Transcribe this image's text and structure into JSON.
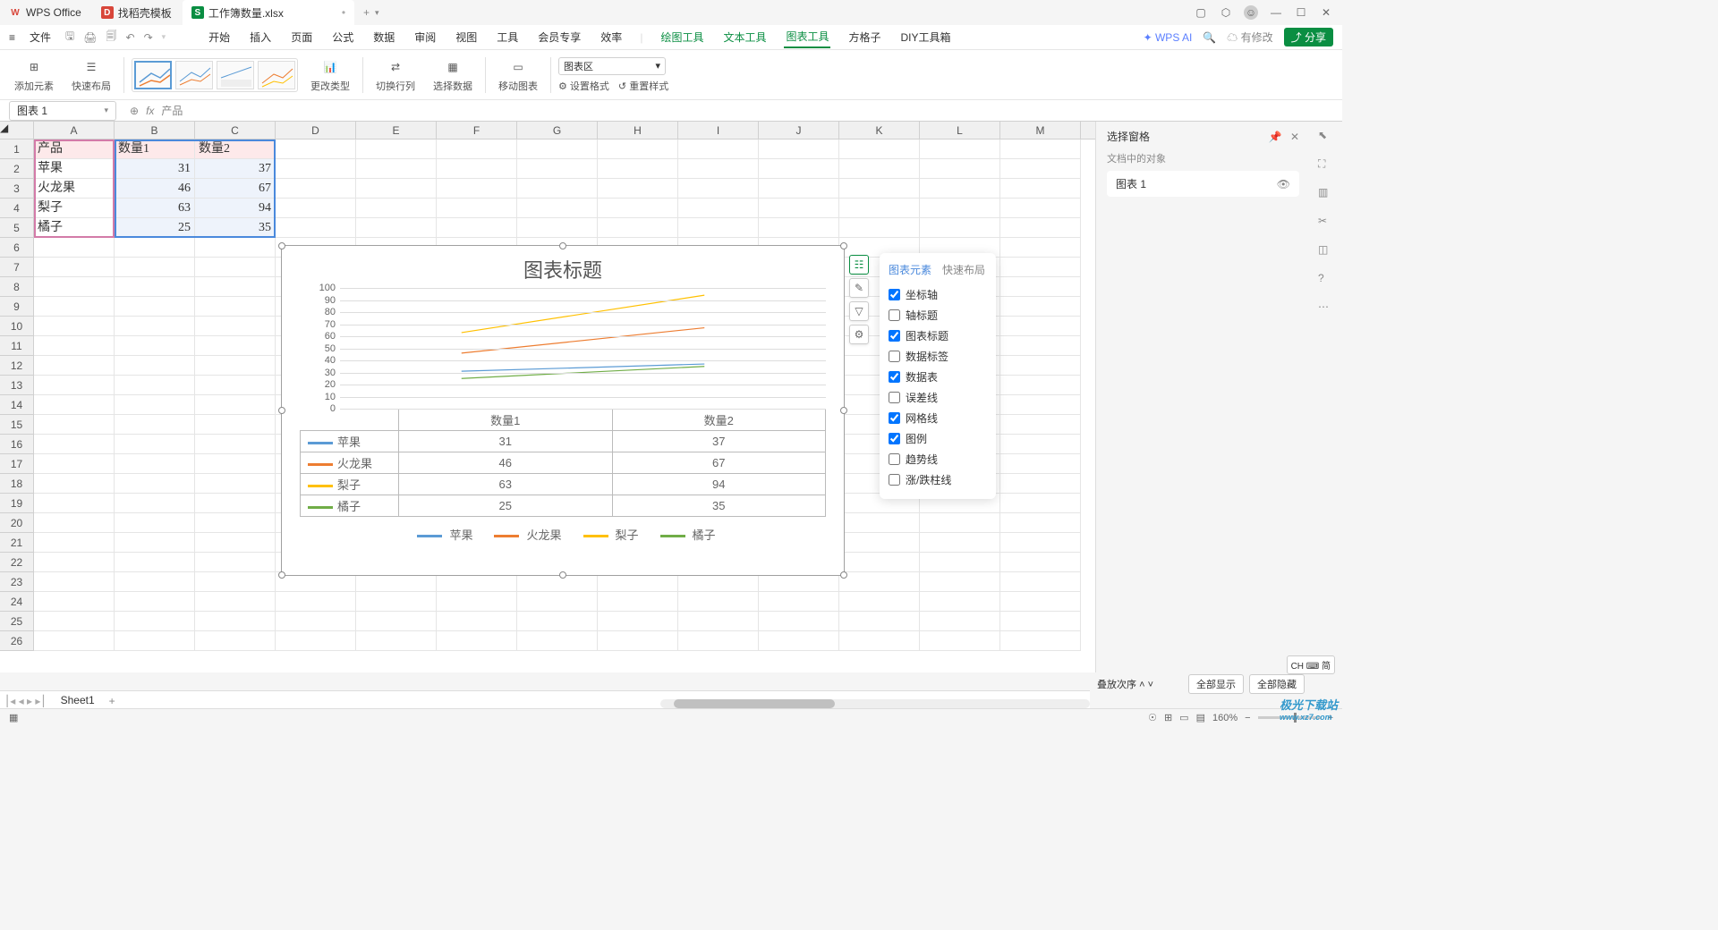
{
  "titlebar": {
    "app_name": "WPS Office",
    "tab_template": "找稻壳模板",
    "tab_file": "工作簿数量.xlsx"
  },
  "menubar": {
    "menu_icon": "≡",
    "file": "文件",
    "tabs": [
      "开始",
      "插入",
      "页面",
      "公式",
      "数据",
      "审阅",
      "视图",
      "工具",
      "会员专享",
      "效率"
    ],
    "tool_tabs": [
      "绘图工具",
      "文本工具",
      "图表工具",
      "方格子",
      "DIY工具箱"
    ],
    "ai": "WPS AI",
    "mod": "有修改",
    "share": "分享"
  },
  "ribbon": {
    "add_elem": "添加元素",
    "quick_layout": "快速布局",
    "change_type": "更改类型",
    "switch_rc": "切换行列",
    "select_data": "选择数据",
    "move_chart": "移动图表",
    "chart_area": "图表区",
    "set_format": "设置格式",
    "reset_style": "重置样式"
  },
  "formula": {
    "name_box": "图表 1",
    "fx": "fx",
    "content": "产品"
  },
  "columns": [
    "A",
    "B",
    "C",
    "D",
    "E",
    "F",
    "G",
    "H",
    "I",
    "J",
    "K",
    "L",
    "M"
  ],
  "rows": [
    "1",
    "2",
    "3",
    "4",
    "5",
    "6",
    "7",
    "8",
    "9",
    "10",
    "11",
    "12",
    "13",
    "14",
    "15",
    "16",
    "17",
    "18",
    "19",
    "20",
    "21",
    "22",
    "23",
    "24",
    "25",
    "26"
  ],
  "grid": {
    "A1": "产品",
    "B1": "数量1",
    "C1": "数量2",
    "A2": "苹果",
    "B2": "31",
    "C2": "37",
    "A3": "火龙果",
    "B3": "46",
    "C3": "67",
    "A4": "梨子",
    "B4": "63",
    "C4": "94",
    "A5": "橘子",
    "B5": "25",
    "C5": "35"
  },
  "chart_data": {
    "type": "line",
    "title": "图表标题",
    "categories": [
      "数量1",
      "数量2"
    ],
    "series": [
      {
        "name": "苹果",
        "values": [
          31,
          37
        ],
        "color": "#5b9bd5"
      },
      {
        "name": "火龙果",
        "values": [
          46,
          67
        ],
        "color": "#ed7d31"
      },
      {
        "name": "梨子",
        "values": [
          63,
          94
        ],
        "color": "#ffc000"
      },
      {
        "name": "橘子",
        "values": [
          25,
          35
        ],
        "color": "#70ad47"
      }
    ],
    "ylim": [
      0,
      100
    ],
    "yticks": [
      0,
      10,
      20,
      30,
      40,
      50,
      60,
      70,
      80,
      90,
      100
    ]
  },
  "popup": {
    "tab_elem": "图表元素",
    "tab_layout": "快速布局",
    "items": [
      {
        "label": "坐标轴",
        "checked": true
      },
      {
        "label": "轴标题",
        "checked": false
      },
      {
        "label": "图表标题",
        "checked": true
      },
      {
        "label": "数据标签",
        "checked": false
      },
      {
        "label": "数据表",
        "checked": true
      },
      {
        "label": "误差线",
        "checked": false
      },
      {
        "label": "网格线",
        "checked": true
      },
      {
        "label": "图例",
        "checked": true
      },
      {
        "label": "趋势线",
        "checked": false
      },
      {
        "label": "涨/跌柱线",
        "checked": false
      }
    ]
  },
  "side": {
    "title": "选择窗格",
    "sub": "文档中的对象",
    "item": "图表 1",
    "order": "叠放次序",
    "show_all": "全部显示",
    "hide_all": "全部隐藏"
  },
  "sheet_tabs": {
    "sheet1": "Sheet1"
  },
  "status": {
    "zoom": "160%"
  },
  "ime": "CH ⌨ 简",
  "watermark": {
    "l1": "极光下载站",
    "l2": "www.xz7.com"
  }
}
